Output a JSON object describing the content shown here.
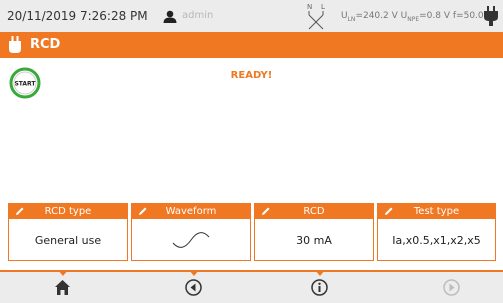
{
  "status": {
    "datetime": "20/11/2019 7:26:28 PM",
    "user": "admin",
    "conn_labels": {
      "n": "N",
      "l": "L"
    },
    "u_ln_label": "U",
    "u_ln_sub": "LN",
    "u_ln_value": "=240.2 V",
    "u_npe_label": "U",
    "u_npe_sub": "NPE",
    "u_npe_value": "=0.8 V",
    "freq": "f=50.0 Hz"
  },
  "header": {
    "title": "RCD"
  },
  "main": {
    "start_label": "START",
    "ready_text": "READY!"
  },
  "params": [
    {
      "label": "RCD type",
      "value": "General use",
      "icon": "pencil-icon"
    },
    {
      "label": "Waveform",
      "value": "",
      "icon": "pencil-icon",
      "value_icon": "sine-wave-icon"
    },
    {
      "label": "RCD",
      "value": "30 mA",
      "icon": "pencil-icon"
    },
    {
      "label": "Test type",
      "value": "Ia,x0.5,x1,x2,x5",
      "icon": "pencil-icon"
    }
  ],
  "nav": [
    {
      "icon": "home-icon"
    },
    {
      "icon": "back-circle-icon"
    },
    {
      "icon": "info-circle-icon"
    },
    {
      "icon": "forward-circle-icon",
      "disabled": true
    }
  ],
  "colors": {
    "accent": "#f07823",
    "start_ring": "#3aa83a",
    "bar": "#ececec"
  }
}
